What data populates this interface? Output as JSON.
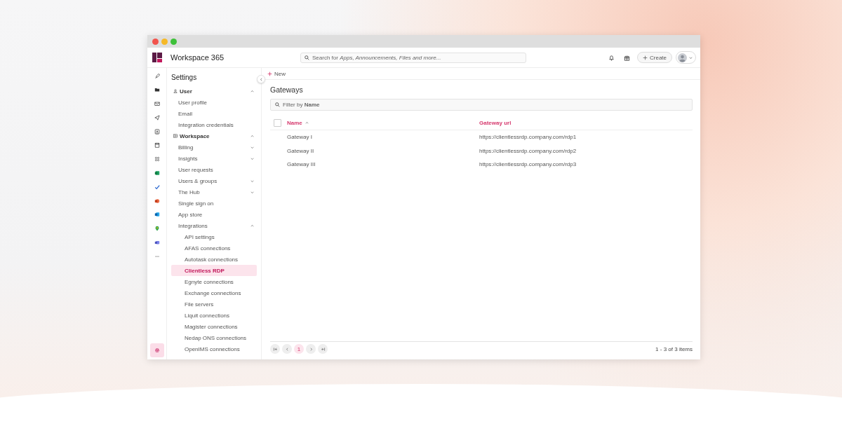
{
  "window": {
    "title": "Workspace 365"
  },
  "header": {
    "search": {
      "placeholder": "Search for *Apps, Announcements, Files and more...*"
    },
    "create_button": "Create"
  },
  "rail": {
    "items": [
      {
        "kind": "rocket",
        "selected": false
      },
      {
        "kind": "folder",
        "selected": false
      },
      {
        "kind": "mail",
        "selected": false
      },
      {
        "kind": "send",
        "selected": false
      },
      {
        "kind": "contact",
        "selected": false
      },
      {
        "kind": "calendar",
        "selected": false
      },
      {
        "kind": "apps",
        "selected": false
      },
      {
        "kind": "sheet",
        "selected": false
      },
      {
        "kind": "check",
        "selected": false
      },
      {
        "kind": "slides",
        "selected": false
      },
      {
        "kind": "mailapp",
        "selected": false
      },
      {
        "kind": "pin",
        "selected": false
      },
      {
        "kind": "chat",
        "selected": false
      },
      {
        "kind": "more",
        "selected": false
      }
    ],
    "settings": {
      "selected": true
    }
  },
  "sidebar": {
    "title": "Settings",
    "items": [
      {
        "label": "User",
        "expanded": true,
        "children": [
          {
            "label": "User profile",
            "selected": false
          },
          {
            "label": "Email",
            "selected": false
          },
          {
            "label": "Integration credentials",
            "selected": false
          }
        ]
      },
      {
        "label": "Workspace",
        "expanded": true,
        "children": [
          {
            "label": "Billing",
            "selected": false,
            "expanded": false
          },
          {
            "label": "Insights",
            "selected": false,
            "expanded": false
          },
          {
            "label": "User requests",
            "selected": false
          },
          {
            "label": "Users & groups",
            "selected": false,
            "expanded": false
          },
          {
            "label": "The Hub",
            "selected": false,
            "expanded": false
          },
          {
            "label": "Single sign on",
            "selected": false
          },
          {
            "label": "App store",
            "selected": false
          },
          {
            "label": "Integrations",
            "selected": false,
            "expanded": true,
            "children": [
              {
                "label": "API settings",
                "selected": false
              },
              {
                "label": "AFAS connections",
                "selected": false
              },
              {
                "label": "Autotask connections",
                "selected": false
              },
              {
                "label": "Clientless RDP",
                "selected": true
              },
              {
                "label": "Egnyte connections",
                "selected": false
              },
              {
                "label": "Exchange connections",
                "selected": false
              },
              {
                "label": "File servers",
                "selected": false
              },
              {
                "label": "Liquit connections",
                "selected": false
              },
              {
                "label": "Magister connections",
                "selected": false
              },
              {
                "label": "Nedap ONS connections",
                "selected": false
              },
              {
                "label": "OpenIMS connections",
                "selected": false
              }
            ]
          }
        ]
      }
    ]
  },
  "toolbar": {
    "new_button": "New"
  },
  "page": {
    "title": "Gateways",
    "filter": {
      "placeholder": "Filter by **Name**"
    }
  },
  "table": {
    "select_all": {
      "checked": false
    },
    "columns": [
      {
        "label": "Name",
        "sorted": true
      },
      {
        "label": "Gateway url",
        "sorted": false
      }
    ],
    "rows": [
      [
        "Gateway I",
        "https://clientlessrdp.company.com/rdp1"
      ],
      [
        "Gateway II",
        "https://clientlessrdp.company.com/rdp2"
      ],
      [
        "Gateway III",
        "https://clientlessrdp.company.com/rdp3"
      ]
    ]
  },
  "pagination": {
    "pages": [
      {
        "label": "1",
        "selected": true
      }
    ],
    "summary": "1 - 3 of 3 items"
  }
}
